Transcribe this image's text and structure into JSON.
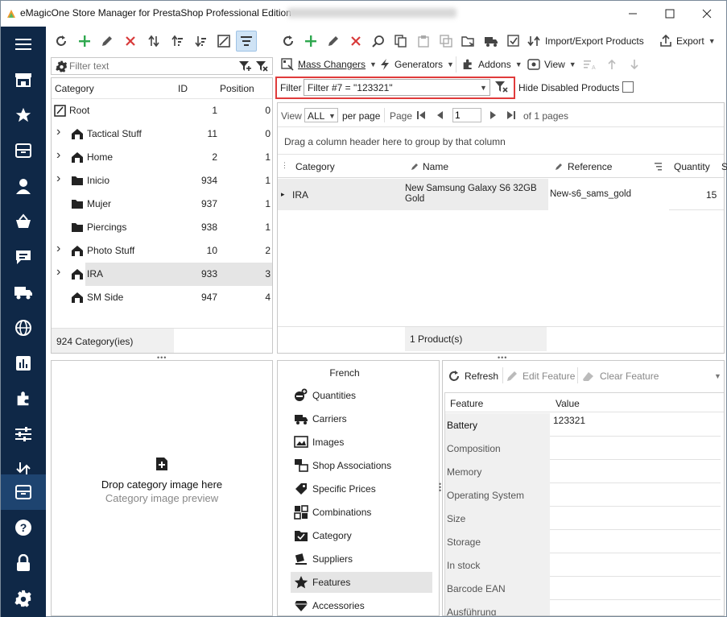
{
  "window": {
    "title": "eMagicOne Store Manager for PrestaShop Professional Edition"
  },
  "sidebar": {
    "items": [
      "menu-icon",
      "store-icon",
      "star-icon",
      "box-icon",
      "user-icon",
      "basket-icon",
      "chat-icon",
      "truck-icon",
      "globe-icon",
      "chart-icon",
      "puzzle-icon",
      "sliders-icon",
      "import-export-icon",
      "archive-icon",
      "help-icon",
      "lock-icon",
      "settings-icon"
    ]
  },
  "categories": {
    "filter_placeholder": "Filter text",
    "headers": {
      "category": "Category",
      "id": "ID",
      "position": "Position"
    },
    "rows": [
      {
        "name": "Root",
        "id": "1",
        "position": "0"
      },
      {
        "name": "Tactical Stuff",
        "id": "11",
        "position": "0"
      },
      {
        "name": "Home",
        "id": "2",
        "position": "1"
      },
      {
        "name": "Inicio",
        "id": "934",
        "position": "1"
      },
      {
        "name": "Mujer",
        "id": "937",
        "position": "1"
      },
      {
        "name": "Piercings",
        "id": "938",
        "position": "1"
      },
      {
        "name": "Photo Stuff",
        "id": "10",
        "position": "2"
      },
      {
        "name": "IRA",
        "id": "933",
        "position": "3"
      },
      {
        "name": "SM Side",
        "id": "947",
        "position": "4"
      }
    ],
    "footer": "924 Category(ies)"
  },
  "image_panel": {
    "drop_text": "Drop category image here",
    "preview_text": "Category image preview"
  },
  "toolbar": {
    "import_export": "Import/Export Products",
    "export": "Export"
  },
  "toolbar2": {
    "mass_changers": "Mass Changers",
    "generators": "Generators",
    "addons": "Addons",
    "view": "View"
  },
  "filter": {
    "label": "Filter",
    "value": "Filter #7 = \"123321\"",
    "hide_disabled": "Hide Disabled Products"
  },
  "pager": {
    "view_label": "View",
    "view_value": "ALL",
    "per_page": "per page",
    "page_label": "Page",
    "page_value": "1",
    "of_pages": "of 1 pages"
  },
  "products": {
    "group_hint": "Drag a column header here to group by that column",
    "headers": {
      "category": "Category",
      "name": "Name",
      "reference": "Reference",
      "quantity": "Quantity",
      "extra": "S"
    },
    "rows": [
      {
        "category": "IRA",
        "name": "New Samsung Galaxy S6 32GB Gold",
        "reference": "New-s6_sams_gold",
        "quantity": "15"
      }
    ],
    "footer": "1 Product(s)"
  },
  "detail_nav": {
    "language": "French",
    "items": [
      "Quantities",
      "Carriers",
      "Images",
      "Shop Associations",
      "Specific Prices",
      "Combinations",
      "Category",
      "Suppliers",
      "Features",
      "Accessories"
    ]
  },
  "features": {
    "refresh": "Refresh",
    "edit": "Edit Feature",
    "clear": "Clear Feature",
    "headers": {
      "feature": "Feature",
      "value": "Value"
    },
    "rows": [
      {
        "feature": "Battery",
        "value": "123321"
      },
      {
        "feature": "Composition",
        "value": ""
      },
      {
        "feature": "Memory",
        "value": ""
      },
      {
        "feature": "Operating System",
        "value": ""
      },
      {
        "feature": "Size",
        "value": ""
      },
      {
        "feature": "Storage",
        "value": ""
      },
      {
        "feature": "In stock",
        "value": ""
      },
      {
        "feature": "Barcode EAN",
        "value": ""
      },
      {
        "feature": "Ausführung",
        "value": ""
      }
    ]
  },
  "colors": {
    "sidebar": "#0f2847",
    "accent_green": "#2fa84f",
    "accent_red": "#d83a3a",
    "highlight": "#e03b3b"
  }
}
